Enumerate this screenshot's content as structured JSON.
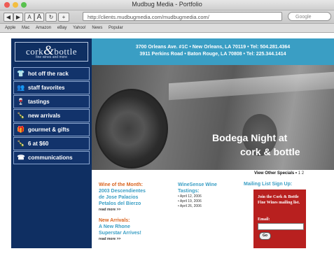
{
  "window": {
    "title": "Mudbug Media - Portfolio",
    "traffic_colors": [
      "#ee5b55",
      "#f3be3f",
      "#58c14e"
    ]
  },
  "toolbar": {
    "back": "◀",
    "forward": "▶",
    "text_small": "A",
    "text_large": "A",
    "add": "+",
    "url": "http://clients.mudbugmedia.com/mudbugmedia.com/",
    "search_placeholder": "Google"
  },
  "bookmarks": [
    "Apple",
    "Mac",
    "Amazon",
    "eBay",
    "Yahoo!",
    "News",
    "Popular"
  ],
  "site": {
    "logo": {
      "left": "cork",
      "amp": "&",
      "right": "bottle",
      "tagline": "fine wines and more"
    },
    "address_line1": "3700 Orleans Ave. #1C • New Orleans, LA 70119 • Tel: 504.281.4364",
    "address_line2": "3911 Perkins Road • Baton Rouge, LA 70808 • Tel: 225.344.1414",
    "nav": [
      {
        "label": "hot off the rack",
        "icon": "shirt-icon",
        "glyph": "👕"
      },
      {
        "label": "staff favorites",
        "icon": "people-icon",
        "glyph": "👥"
      },
      {
        "label": "tastings",
        "icon": "glass-icon",
        "glyph": "🍷"
      },
      {
        "label": "new arrivals",
        "icon": "bottles-icon",
        "glyph": "🍾"
      },
      {
        "label": "gourmet & gifts",
        "icon": "gift-icon",
        "glyph": "🎁"
      },
      {
        "label": "6 at $60",
        "icon": "bottle-icon",
        "glyph": "🍾"
      },
      {
        "label": "communications",
        "icon": "phone-icon",
        "glyph": "☎"
      }
    ],
    "hero": {
      "line1": "Bodega Night at",
      "line2": "cork & bottle"
    },
    "specials": {
      "label": "View Other Specials • ",
      "pages": "1 2"
    },
    "wine_of_month": {
      "heading": "Wine of the Month:",
      "lines": [
        "2003 Descendientes",
        "de Jose Palacios",
        "Petalos del Bierzo"
      ],
      "more": "read more >>"
    },
    "new_arrivals": {
      "heading": "New Arrivals:",
      "lines": [
        "A New Rhone",
        "Superstar Arrives!"
      ],
      "more": "read more >>"
    },
    "winesense": {
      "heading_line1": "WineSense Wine",
      "heading_line2": "Tastings:",
      "dates": [
        "• April 12, 2006",
        "• April 19, 2006",
        "• April 26, 2006"
      ]
    },
    "mailing": {
      "heading": "Mailing List Sign Up:",
      "text": "Join the Cork & Bottle Fine Wines mailing list.",
      "email_label": "Email:",
      "go": "Go"
    },
    "colors": {
      "navy": "#0f2f62",
      "teal": "#3a9ec4",
      "orange": "#d9621c",
      "red": "#b8201f"
    }
  }
}
